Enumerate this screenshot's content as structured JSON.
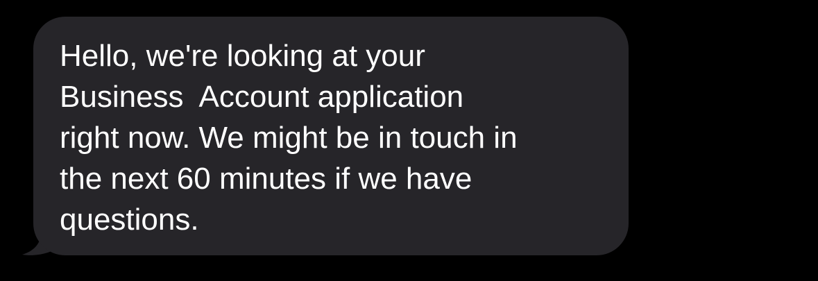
{
  "message": {
    "sender": "incoming",
    "text": "Hello, we're looking at your\nBusiness  Account application\nright now. We might be in touch in\nthe next 60 minutes if we have\nquestions."
  },
  "colors": {
    "background": "#000000",
    "bubble": "#262529",
    "text": "#ffffff"
  }
}
